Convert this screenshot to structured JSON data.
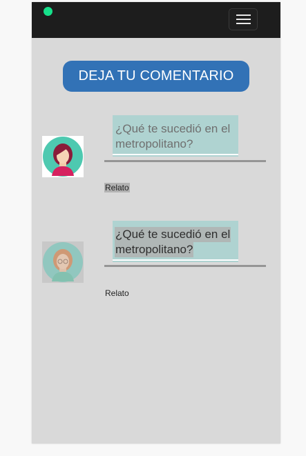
{
  "header": {
    "status_dot_color": "#16e08a",
    "menu_icon": "hamburger-menu-icon"
  },
  "cta": {
    "label": "DEJA TU COMENTARIO",
    "color": "#3272b6"
  },
  "stories": [
    {
      "avatar": "woman-avatar-icon",
      "question_line1": "¿Qué te sucedió en el",
      "question_line2": "metropolitano?",
      "link_label": "Relato"
    },
    {
      "avatar": "woman-avatar-icon",
      "question_line1": "¿Qué te sucedió en el",
      "question_line2": "metropolitano?",
      "link_label": "Relato"
    }
  ]
}
